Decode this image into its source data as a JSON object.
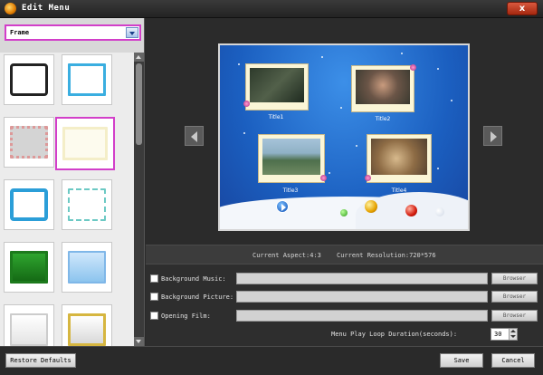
{
  "window": {
    "title": "Edit Menu",
    "close_label": "x"
  },
  "left_panel": {
    "dropdown_value": "Frame",
    "frames": [
      {
        "name": "frame-thumb-1",
        "style": "black-rounded"
      },
      {
        "name": "frame-thumb-2",
        "style": "light-blue"
      },
      {
        "name": "frame-thumb-3",
        "style": "gray-floral"
      },
      {
        "name": "frame-thumb-4",
        "style": "cream-floral",
        "selected": true
      },
      {
        "name": "frame-thumb-5",
        "style": "blue-rounded"
      },
      {
        "name": "frame-thumb-6",
        "style": "teal-dotted"
      },
      {
        "name": "frame-thumb-7",
        "style": "green-film"
      },
      {
        "name": "frame-thumb-8",
        "style": "sky-blue"
      },
      {
        "name": "frame-thumb-9",
        "style": "white"
      },
      {
        "name": "frame-thumb-10",
        "style": "gold"
      }
    ]
  },
  "preview": {
    "titles": [
      "Title1",
      "Title2",
      "Title3",
      "Title4"
    ]
  },
  "status": {
    "aspect": "Current Aspect:4:3",
    "resolution": "Current Resolution:720*576"
  },
  "settings": {
    "background_music_label": "Background Music:",
    "background_picture_label": "Background Picture:",
    "opening_film_label": "Opening Film:",
    "browse_label": "Browser",
    "loop_label": "Menu Play Loop Duration(seconds):",
    "loop_value": "30"
  },
  "footer": {
    "restore_label": "Restore Defaults",
    "save_label": "Save",
    "cancel_label": "Cancel"
  },
  "colors": {
    "accent_highlight": "#d23fc9",
    "canvas_blue": "#1b5fc0",
    "close_red": "#c4401f"
  }
}
